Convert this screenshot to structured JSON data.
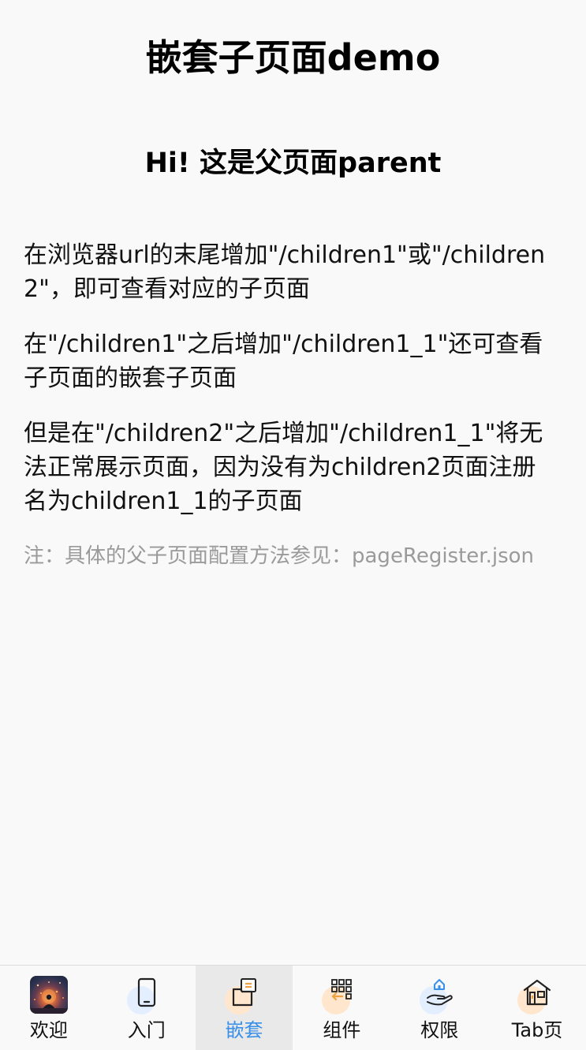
{
  "header": {
    "title": "嵌套子页面demo",
    "subtitle": "Hi! 这是父页面parent"
  },
  "content": {
    "paragraphs": [
      "在浏览器url的末尾增加\"/children1\"或\"/children2\"，即可查看对应的子页面",
      "在\"/children1\"之后增加\"/children1_1\"还可查看子页面的嵌套子页面",
      "但是在\"/children2\"之后增加\"/children1_1\"将无法正常展示页面，因为没有为children2页面注册名为children1_1的子页面"
    ],
    "note": "注：具体的父子页面配置方法参见：pageRegister.json"
  },
  "tabbar": {
    "active_index": 2,
    "active_color": "#3a90e8",
    "items": [
      {
        "label": "欢迎",
        "icon": "welcome-avatar-icon"
      },
      {
        "label": "入门",
        "icon": "phone-icon"
      },
      {
        "label": "嵌套",
        "icon": "nested-pages-icon"
      },
      {
        "label": "组件",
        "icon": "components-grid-icon"
      },
      {
        "label": "权限",
        "icon": "permission-hand-icon"
      },
      {
        "label": "Tab页",
        "icon": "house-tab-icon"
      }
    ]
  }
}
